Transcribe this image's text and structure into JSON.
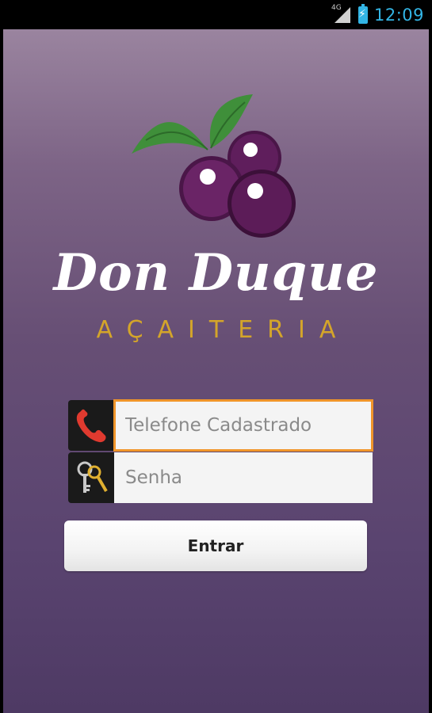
{
  "status_bar": {
    "network": "4G",
    "time": "12:09",
    "accent_color": "#33b5e5"
  },
  "brand": {
    "name": "Don Duque",
    "subtitle": "AÇAITERIA",
    "subtitle_color": "#d4a52a",
    "logo_icon": "acai-berries-icon"
  },
  "login": {
    "phone_placeholder": "Telefone Cadastrado",
    "password_placeholder": "Senha",
    "phone_icon": "phone-icon",
    "password_icon": "keys-icon",
    "focus_color": "#f0952a",
    "submit_label": "Entrar"
  }
}
